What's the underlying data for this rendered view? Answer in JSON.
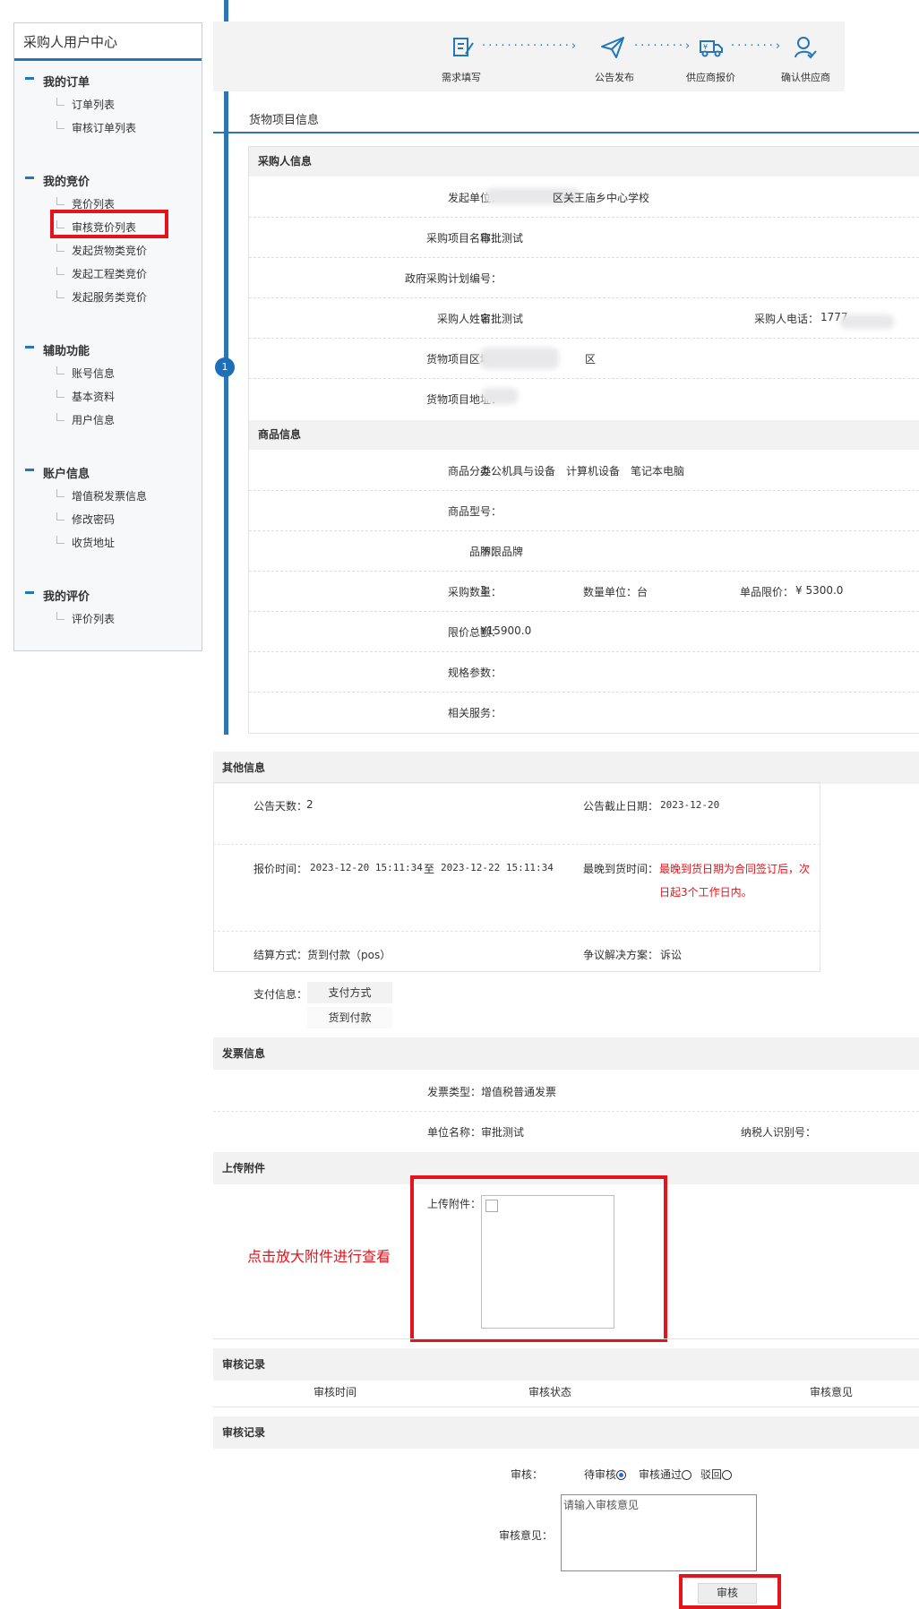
{
  "sidebar": {
    "title": "采购人用户中心",
    "groups": [
      {
        "label": "我的订单",
        "items": [
          "订单列表",
          "审核订单列表"
        ]
      },
      {
        "label": "我的竞价",
        "items": [
          "竞价列表",
          "审核竞价列表",
          "发起货物类竞价",
          "发起工程类竞价",
          "发起服务类竞价"
        ]
      },
      {
        "label": "辅助功能",
        "items": [
          "账号信息",
          "基本资料",
          "用户信息"
        ]
      },
      {
        "label": "账户信息",
        "items": [
          "增值税发票信息",
          "修改密码",
          "收货地址"
        ]
      },
      {
        "label": "我的评价",
        "items": [
          "评价列表"
        ]
      }
    ]
  },
  "steps": [
    "需求填写",
    "公告发布",
    "供应商报价",
    "确认供应商"
  ],
  "timeline_step": "1",
  "section_tab": "货物项目信息",
  "purchaser": {
    "header": "采购人信息",
    "unit_label": "发起单位：",
    "unit_value": "区关王庙乡中心学校",
    "project_label": "采购项目名称：",
    "project_value": "审批测试",
    "plan_label": "政府采购计划编号：",
    "name_label": "采购人姓名：",
    "name_value": "审批测试",
    "phone_label": "采购人电话：",
    "phone_value": "1777",
    "region_label": "货物项目区域：",
    "region_value": "区",
    "address_label": "货物项目地址："
  },
  "goods": {
    "header": "商品信息",
    "category_label": "商品分类：",
    "category_value": "办公机具与设备　计算机设备　笔记本电脑",
    "model_label": "商品型号：",
    "brand_label": "品牌：",
    "brand_value": "不限品牌",
    "qty_label": "采购数量：",
    "qty_value": "3",
    "unit_label": "数量单位：",
    "unit_value": "台",
    "price_label": "单品限价：",
    "price_value": "¥ 5300.0",
    "total_label": "限价总额：",
    "total_value": "¥15900.0",
    "spec_label": "规格参数：",
    "service_label": "相关服务："
  },
  "other": {
    "header": "其他信息",
    "days_label": "公告天数：",
    "days_value": "2",
    "deadline_label": "公告截止日期：",
    "deadline_value": "2023-12-20",
    "quote_label": "报价时间：",
    "quote_from": "2023-12-20 15:11:34",
    "quote_to_word": "至",
    "quote_to": "2023-12-22 15:11:34",
    "delivery_label": "最晚到货时间：",
    "delivery_line1": "最晚到货日期为合同签订后，次",
    "delivery_line2": "日起3个工作日内。",
    "settle_label": "结算方式：",
    "settle_value": "货到付款（pos）",
    "dispute_label": "争议解决方案：",
    "dispute_value": "诉讼",
    "pay_label": "支付信息：",
    "pay_header": "支付方式",
    "pay_value": "货到付款"
  },
  "invoice": {
    "header": "发票信息",
    "type_label": "发票类型：",
    "type_value": "增值税普通发票",
    "unit_label": "单位名称：",
    "unit_value": "审批测试",
    "tax_label": "纳税人识别号："
  },
  "attachment": {
    "header": "上传附件",
    "label": "上传附件：",
    "note": "点击放大附件进行查看"
  },
  "records": {
    "header": "审核记录",
    "columns": [
      "审核时间",
      "审核状态",
      "审核意见"
    ]
  },
  "audit": {
    "header": "审核记录",
    "label": "审核：",
    "options": [
      "待审核",
      "审核通过",
      "驳回"
    ],
    "opinion_label": "审核意见：",
    "opinion_placeholder": "请输入审核意见",
    "submit": "审核"
  },
  "colors": {
    "accent": "#2f75b5",
    "highlight_red": "#e3141b"
  }
}
